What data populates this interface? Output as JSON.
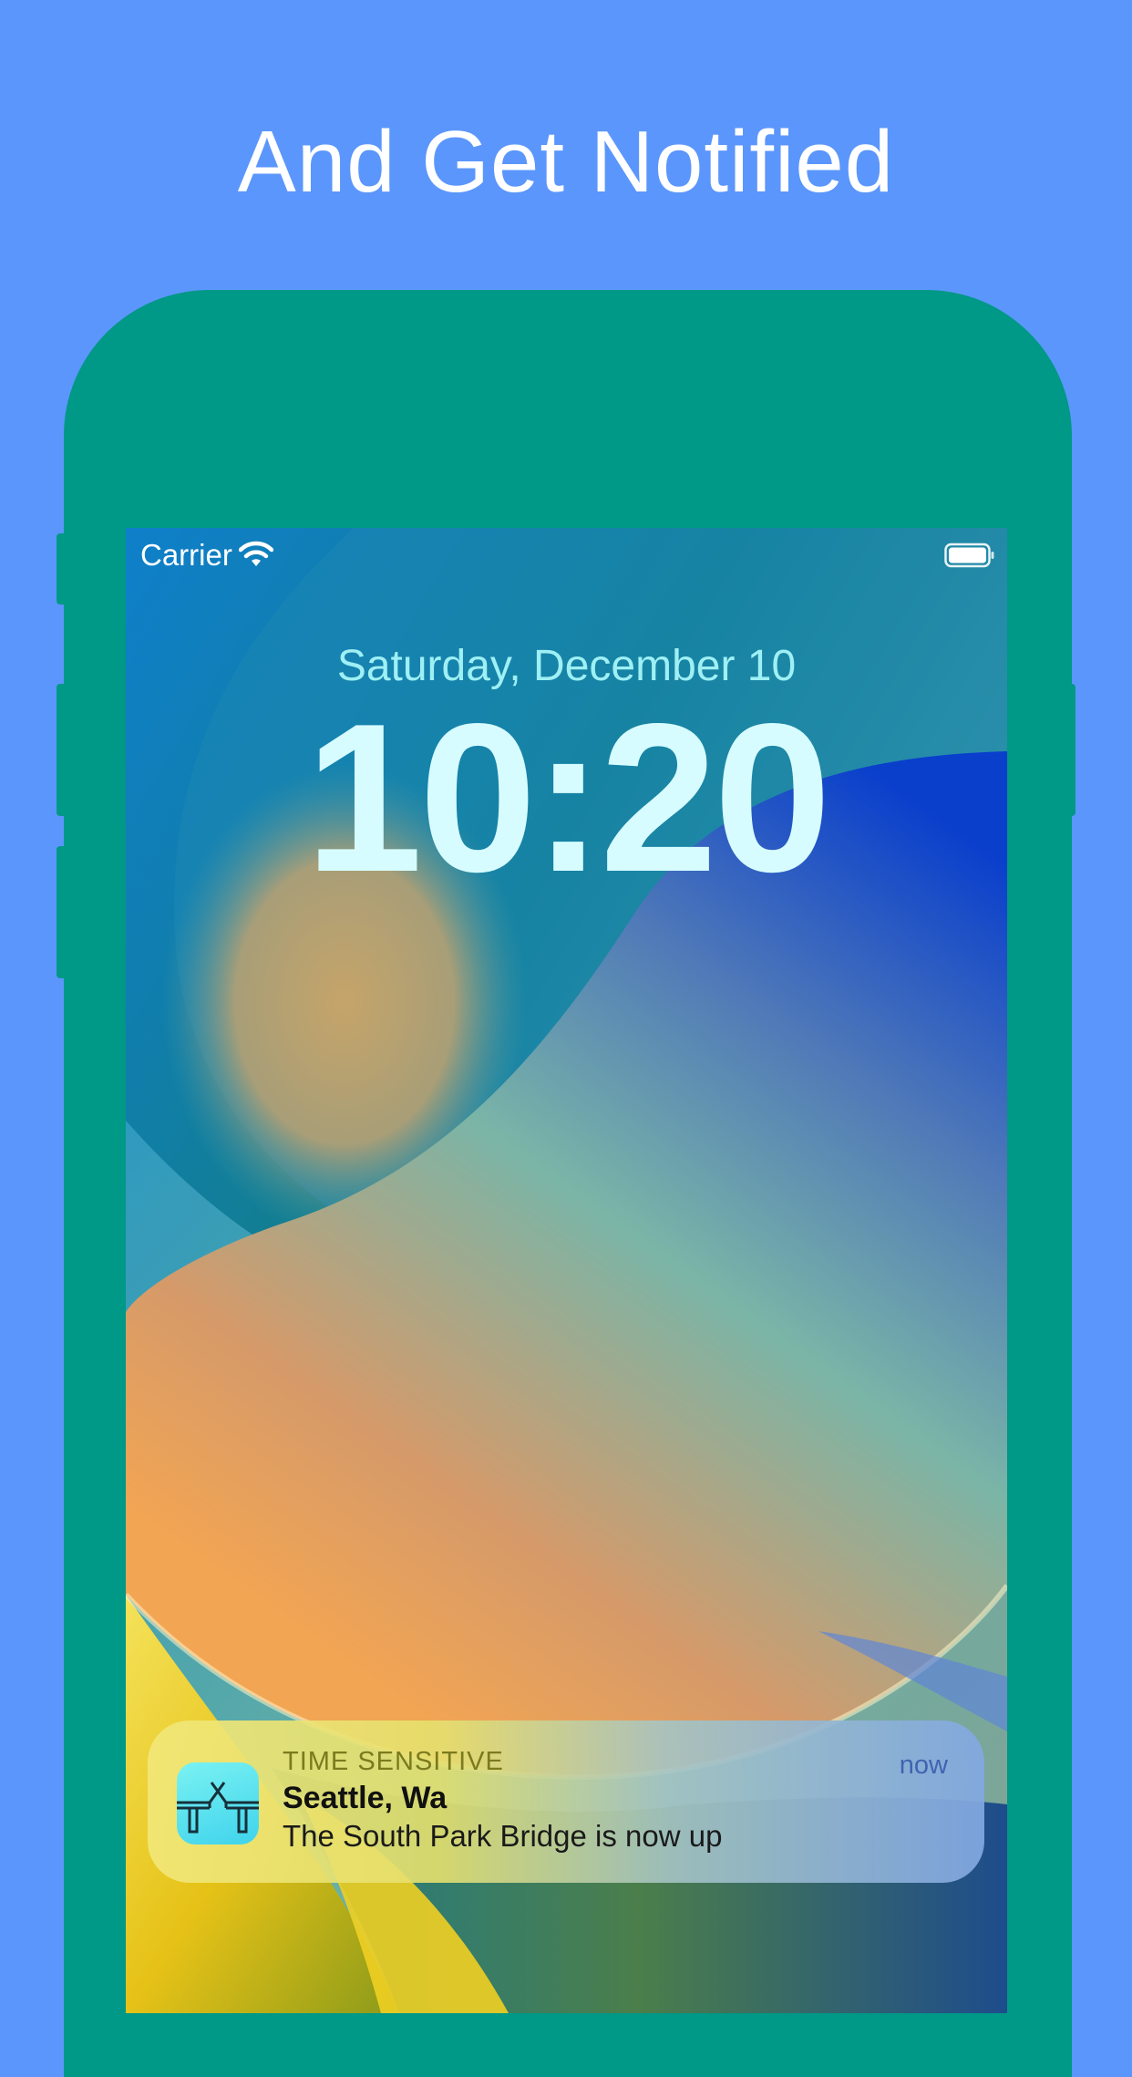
{
  "page": {
    "headline": "And Get Notified"
  },
  "status_bar": {
    "carrier": "Carrier",
    "wifi_icon": "wifi-icon",
    "battery_icon": "battery-full-icon"
  },
  "lock_screen": {
    "date": "Saturday, December 10",
    "time": "10:20"
  },
  "notification": {
    "app_icon": "bridge-icon",
    "category": "TIME SENSITIVE",
    "time": "now",
    "title": "Seattle, Wa",
    "body": "The South Park Bridge is now up"
  },
  "colors": {
    "background": "#5b96fc",
    "device_frame": "#009886",
    "date_text": "#9ef0f4",
    "clock_text": "#d7fcff"
  }
}
